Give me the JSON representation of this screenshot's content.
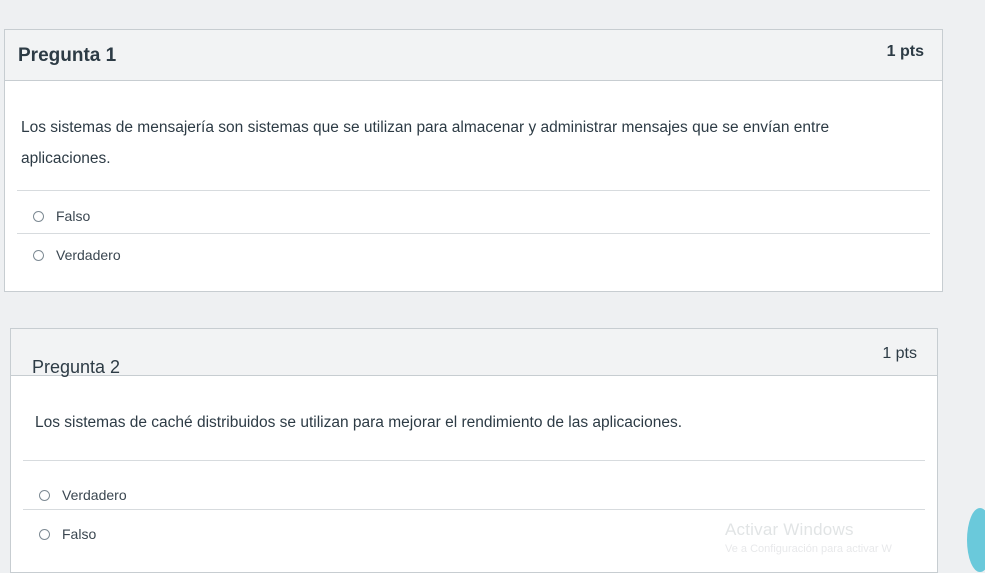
{
  "questions": [
    {
      "title": "Pregunta 1",
      "points": "1 pts",
      "text": "Los sistemas de mensajería son sistemas que se utilizan para almacenar y administrar mensajes que se envían entre aplicaciones.",
      "answers": [
        "Falso",
        "Verdadero"
      ]
    },
    {
      "title": "Pregunta 2",
      "points": "1 pts",
      "text": "Los sistemas de caché distribuidos se utilizan para mejorar el rendimiento de las aplicaciones.",
      "answers": [
        "Verdadero",
        "Falso"
      ]
    }
  ],
  "watermark": {
    "title": "Activar Windows",
    "subtitle": "Ve a Configuración para activar W"
  }
}
